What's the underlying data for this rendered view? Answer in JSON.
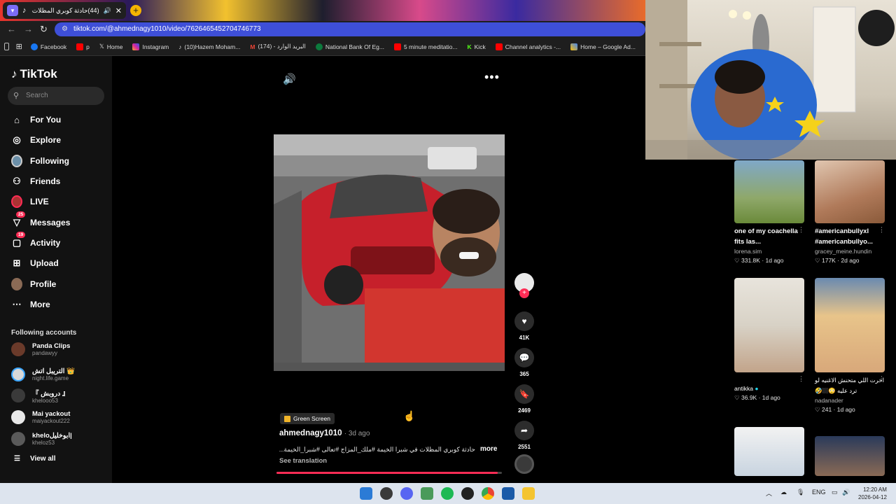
{
  "browser": {
    "tab_title": "(44)حادثة كوبري المظلات في",
    "url": "tiktok.com/@ahmednagy1010/video/7626465452704746773",
    "bookmarks": [
      "Facebook",
      "p",
      "Home",
      "Instagram",
      "(10)Hazem Moham...",
      "(174) - البريد الوارد",
      "National Bank Of Eg...",
      "5 minute meditatio...",
      "Kick",
      "Channel analytics -...",
      "Home – Google Ad..."
    ]
  },
  "sidebar": {
    "logo": "TikTok",
    "search_placeholder": "Search",
    "nav": [
      {
        "label": "For You",
        "icon": "home-icon"
      },
      {
        "label": "Explore",
        "icon": "compass-icon"
      },
      {
        "label": "Following",
        "icon": "following-icon"
      },
      {
        "label": "Friends",
        "icon": "friends-icon"
      },
      {
        "label": "LIVE",
        "icon": "live-icon"
      },
      {
        "label": "Messages",
        "icon": "messages-icon",
        "badge": "25"
      },
      {
        "label": "Activity",
        "icon": "activity-icon",
        "badge": "19"
      },
      {
        "label": "Upload",
        "icon": "upload-icon"
      },
      {
        "label": "Profile",
        "icon": "profile-icon"
      },
      {
        "label": "More",
        "icon": "more-icon"
      }
    ],
    "following_title": "Following accounts",
    "following": [
      {
        "name": "Panda Clips",
        "handle": "pandawyy"
      },
      {
        "name": "التريبل اتش 👑",
        "handle": "night.life.game"
      },
      {
        "name": "『 دروبش 』",
        "handle": "khelooo53"
      },
      {
        "name": "Mai yackout",
        "handle": "maiyackout222"
      },
      {
        "name": "kheloاﺑﻮﺧﻠﻴﻞ|",
        "handle": "kheloz53"
      }
    ],
    "view_all": "View all"
  },
  "video": {
    "likes": "41K",
    "comments": "365",
    "saves": "2469",
    "shares": "2551",
    "effect_label": "Green Screen",
    "author": "ahmednagy1010",
    "age": "3d ago",
    "caption": "حادثة كوبري المظلات في شبرا الخيمة #ملك_المزاج #تعالى #شبرا_الخيمة...",
    "more_label": "more",
    "see_translation": "See translation",
    "progress": 0.98
  },
  "recommendations": [
    {
      "title": "one of my coachella fits las...",
      "user": "lorena.sim",
      "likes": "331.8K",
      "age": "1d ago"
    },
    {
      "title": "#americanbullyxl #americanbullyo...",
      "user": "gracey_meine.hundin",
      "likes": "177K",
      "age": "2d ago"
    },
    {
      "title": "",
      "user": "antikka",
      "likes": "36.9K",
      "age": "1d ago"
    },
    {
      "title": "اخرت اللي متحنش الاغنيه لو ترد عليه 😳🏼🤣",
      "user": "nadanader",
      "likes": "241",
      "age": "1d ago"
    }
  ],
  "taskbar": {
    "lang": "ENG",
    "time": "12:20 AM",
    "date": "2026-04-12"
  }
}
